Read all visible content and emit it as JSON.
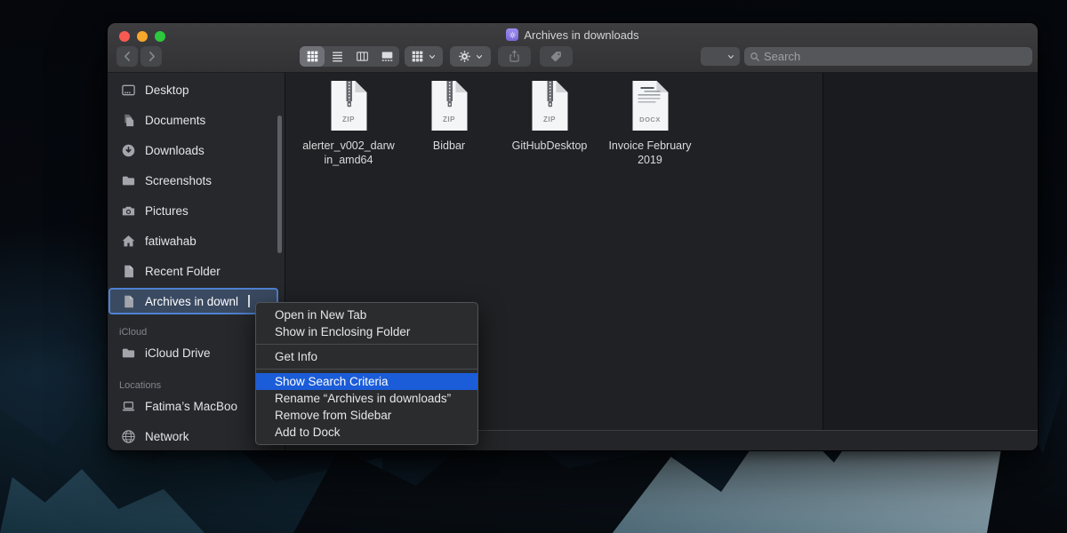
{
  "window": {
    "title": "Archives in downloads",
    "search": {
      "placeholder": "Search"
    }
  },
  "sidebar": {
    "sections": [
      {
        "header": "",
        "items": [
          {
            "label": "Desktop"
          },
          {
            "label": "Documents"
          },
          {
            "label": "Downloads"
          },
          {
            "label": "Screenshots"
          },
          {
            "label": "Pictures"
          },
          {
            "label": "fatiwahab"
          },
          {
            "label": "Recent Folder"
          },
          {
            "label": "Archives in downl",
            "selected": true
          }
        ]
      },
      {
        "header": "iCloud",
        "items": [
          {
            "label": "iCloud Drive"
          }
        ]
      },
      {
        "header": "Locations",
        "items": [
          {
            "label": "Fatima’s MacBoo"
          },
          {
            "label": "Network"
          }
        ]
      }
    ]
  },
  "files": [
    {
      "line1": "alerter_v002_darw",
      "line2": "in_amd64",
      "badge": "ZIP"
    },
    {
      "line1": "Bidbar",
      "line2": "",
      "badge": "ZIP"
    },
    {
      "line1": "GitHubDesktop",
      "line2": "",
      "badge": "ZIP"
    },
    {
      "line1": "Invoice February",
      "line2": "2019",
      "badge": "DOCX"
    }
  ],
  "context_menu": {
    "items": [
      {
        "label": "Open in New Tab"
      },
      {
        "label": "Show in Enclosing Folder"
      },
      {
        "separator": true
      },
      {
        "label": "Get Info"
      },
      {
        "separator": true
      },
      {
        "label": "Show Search Criteria",
        "highlighted": true
      },
      {
        "label": "Rename “Archives in downloads”"
      },
      {
        "label": "Remove from Sidebar"
      },
      {
        "label": "Add to Dock"
      }
    ]
  },
  "colors": {
    "menu_highlight": "#1b5cd8",
    "sidebar_selection_bg": "#3a4a61",
    "sidebar_selection_ring": "#4f80cf",
    "smart_folder_purple": "#8d7ae8",
    "traffic_red": "#f85a52",
    "traffic_yellow": "#f6a72c",
    "traffic_green": "#2dc83d"
  }
}
